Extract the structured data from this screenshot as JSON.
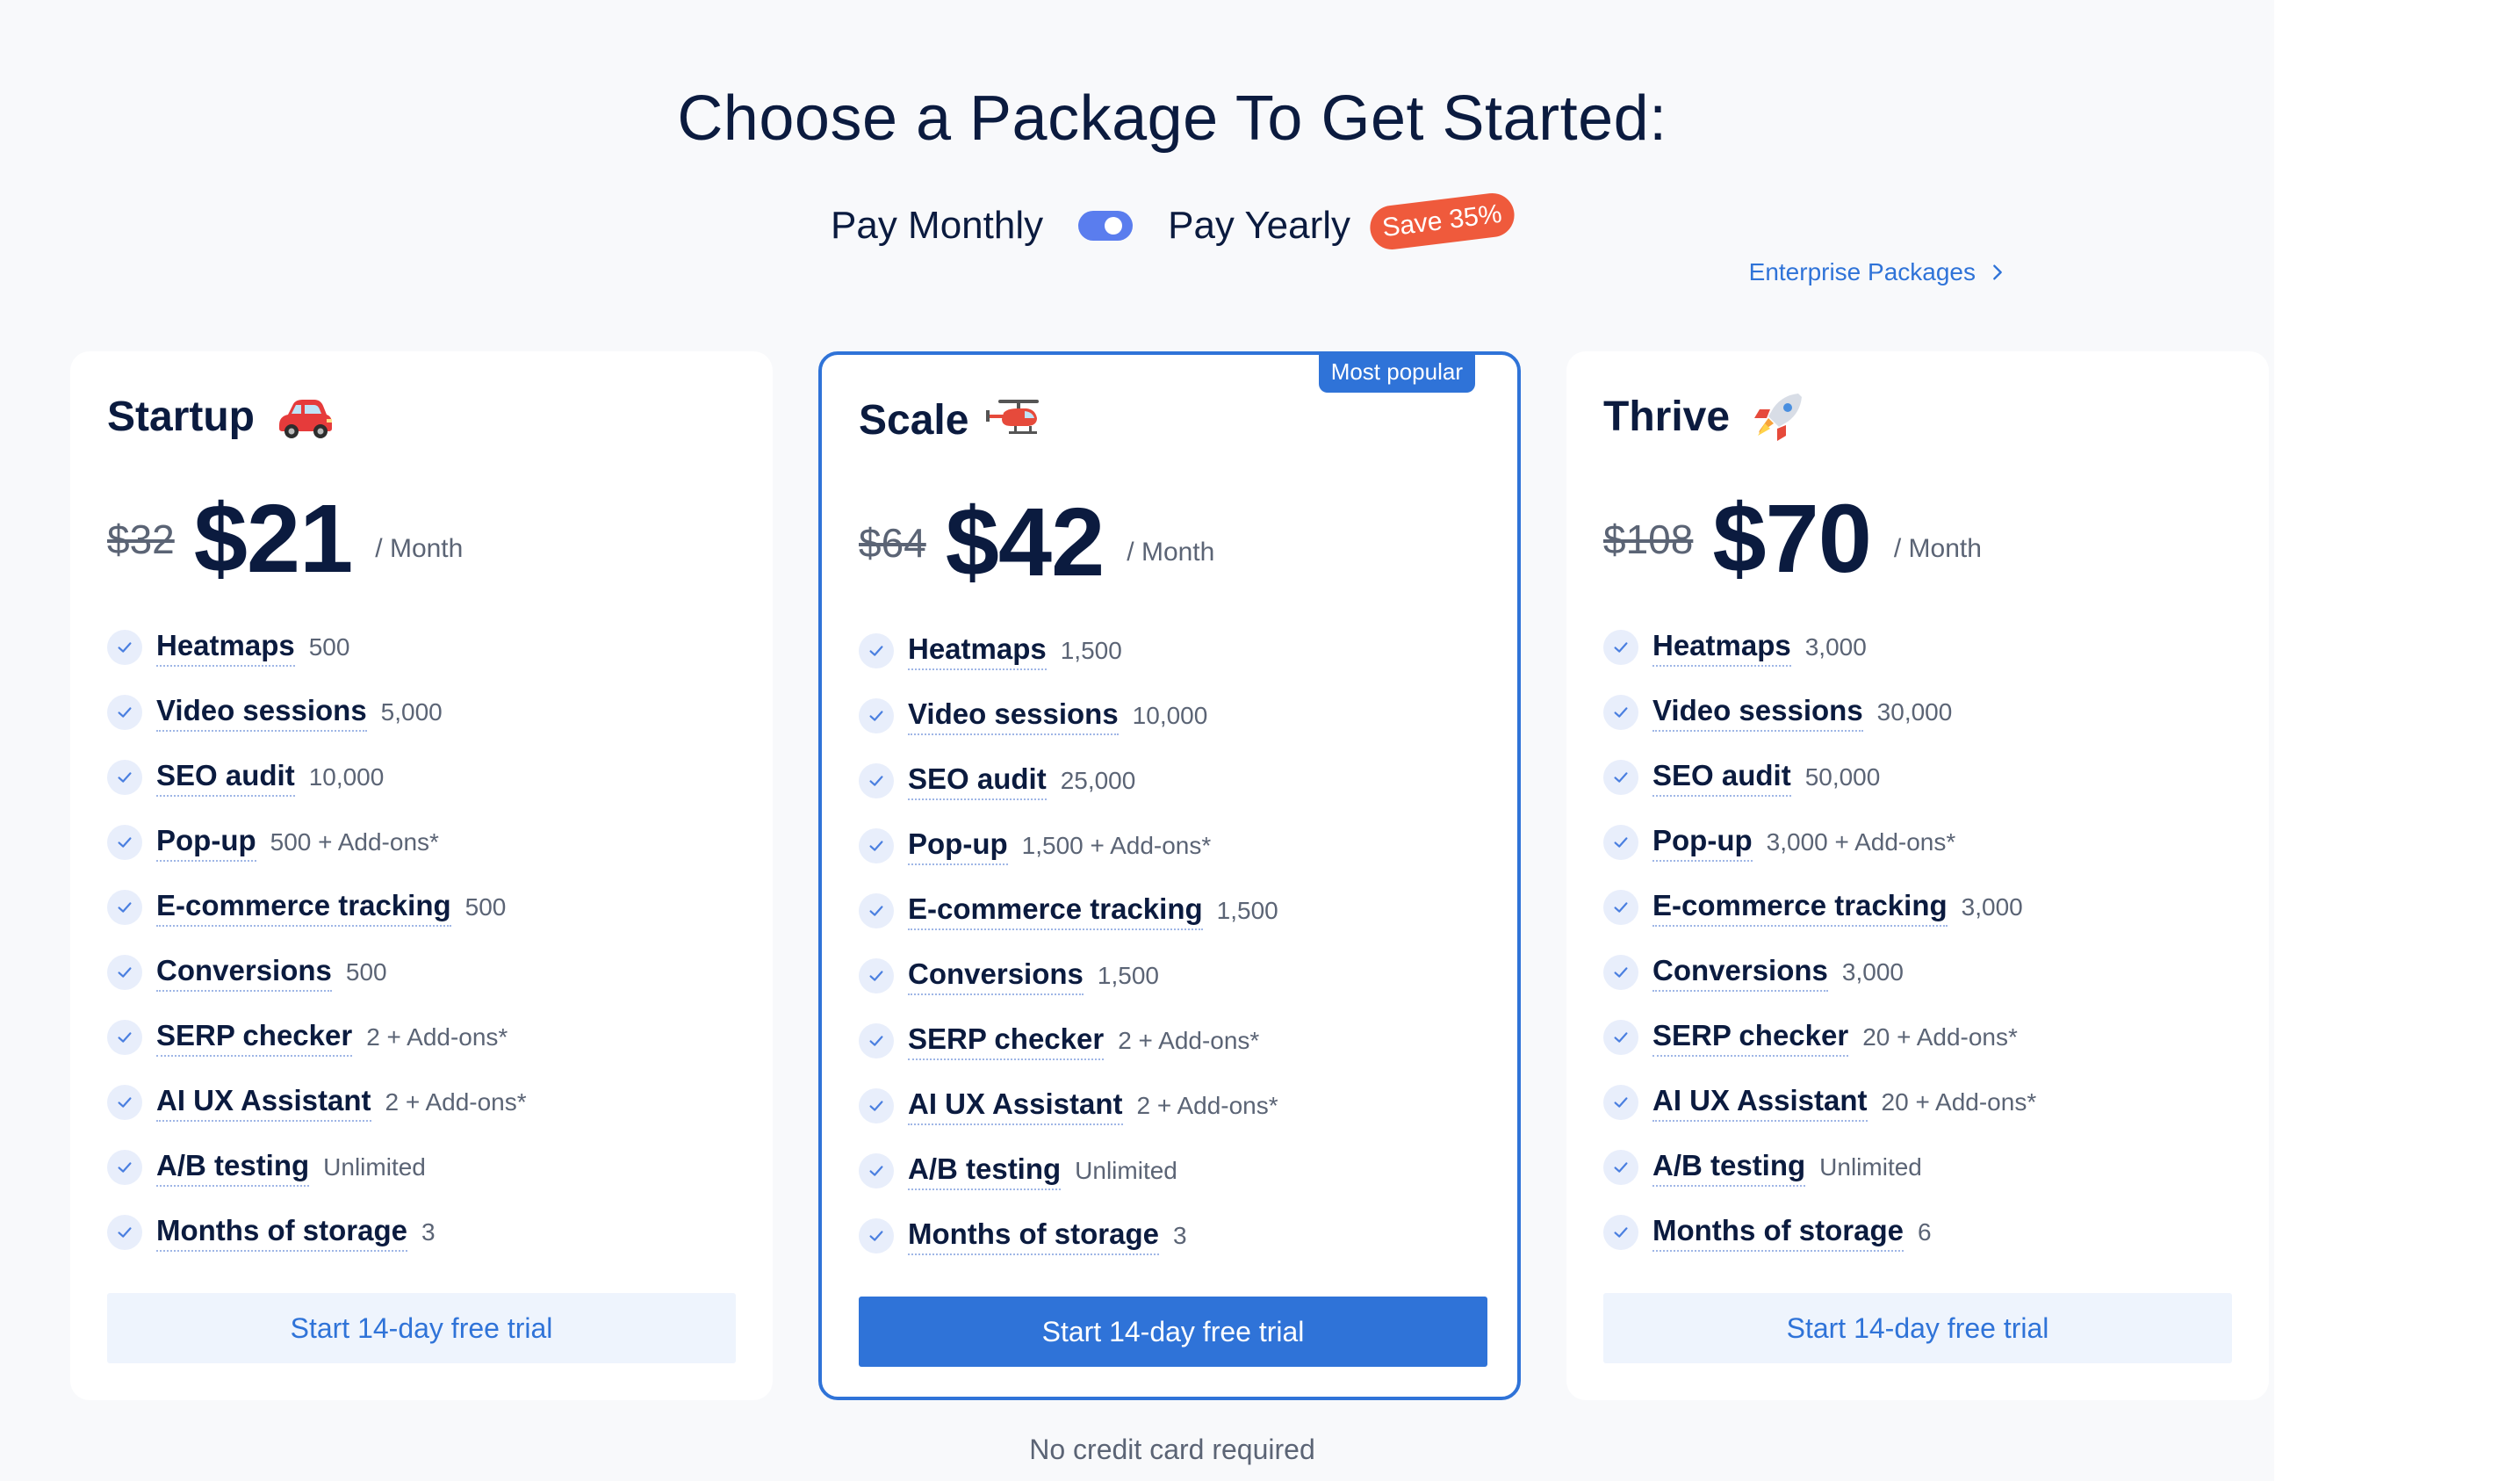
{
  "heading": "Choose a Package To Get Started:",
  "billing": {
    "monthly_label": "Pay Monthly",
    "yearly_label": "Pay Yearly",
    "save_badge": "Save 35%",
    "selected": "yearly"
  },
  "enterprise_link": "Enterprise Packages",
  "most_popular_label": "Most popular",
  "per_label": "/ Month",
  "cta_label": "Start 14-day free trial",
  "footnote": "No credit card required",
  "colors": {
    "accent": "#2f73d8",
    "badge": "#ef5a3c",
    "text": "#0b1b3f"
  },
  "plans": [
    {
      "name": "Startup",
      "emoji": "car",
      "old_price": "$32",
      "price": "$21",
      "features": [
        {
          "name": "Heatmaps",
          "value": "500"
        },
        {
          "name": "Video sessions",
          "value": "5,000"
        },
        {
          "name": "SEO audit",
          "value": "10,000"
        },
        {
          "name": "Pop-up",
          "value": "500 + Add-ons*"
        },
        {
          "name": "E-commerce tracking",
          "value": "500"
        },
        {
          "name": "Conversions",
          "value": "500"
        },
        {
          "name": "SERP checker",
          "value": "2 + Add-ons*"
        },
        {
          "name": "AI UX Assistant",
          "value": "2 + Add-ons*"
        },
        {
          "name": "A/B testing",
          "value": "Unlimited"
        },
        {
          "name": "Months of storage",
          "value": "3"
        }
      ]
    },
    {
      "name": "Scale",
      "emoji": "helicopter",
      "old_price": "$64",
      "price": "$42",
      "features": [
        {
          "name": "Heatmaps",
          "value": "1,500"
        },
        {
          "name": "Video sessions",
          "value": "10,000"
        },
        {
          "name": "SEO audit",
          "value": "25,000"
        },
        {
          "name": "Pop-up",
          "value": "1,500 + Add-ons*"
        },
        {
          "name": "E-commerce tracking",
          "value": "1,500"
        },
        {
          "name": "Conversions",
          "value": "1,500"
        },
        {
          "name": "SERP checker",
          "value": "2 + Add-ons*"
        },
        {
          "name": "AI UX Assistant",
          "value": "2 + Add-ons*"
        },
        {
          "name": "A/B testing",
          "value": "Unlimited"
        },
        {
          "name": "Months of storage",
          "value": "3"
        }
      ]
    },
    {
      "name": "Thrive",
      "emoji": "rocket",
      "old_price": "$108",
      "price": "$70",
      "features": [
        {
          "name": "Heatmaps",
          "value": "3,000"
        },
        {
          "name": "Video sessions",
          "value": "30,000"
        },
        {
          "name": "SEO audit",
          "value": "50,000"
        },
        {
          "name": "Pop-up",
          "value": "3,000 + Add-ons*"
        },
        {
          "name": "E-commerce tracking",
          "value": "3,000"
        },
        {
          "name": "Conversions",
          "value": "3,000"
        },
        {
          "name": "SERP checker",
          "value": "20 + Add-ons*"
        },
        {
          "name": "AI UX Assistant",
          "value": "20 + Add-ons*"
        },
        {
          "name": "A/B testing",
          "value": "Unlimited"
        },
        {
          "name": "Months of storage",
          "value": "6"
        }
      ]
    }
  ]
}
